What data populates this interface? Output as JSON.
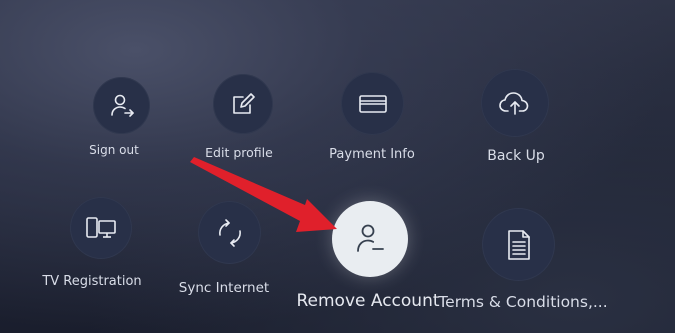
{
  "menu": {
    "items": [
      {
        "label": "Sign out",
        "icon": "sign-out-icon"
      },
      {
        "label": "Edit profile",
        "icon": "edit-profile-icon"
      },
      {
        "label": "Payment Info",
        "icon": "payment-card-icon"
      },
      {
        "label": "Back Up",
        "icon": "cloud-upload-icon"
      },
      {
        "label": "TV Registration",
        "icon": "devices-icon"
      },
      {
        "label": "Sync Internet",
        "icon": "sync-icon"
      },
      {
        "label": "Remove Account",
        "icon": "remove-user-icon"
      },
      {
        "label": "Terms & Conditions,...",
        "icon": "document-icon"
      }
    ],
    "focused_item": "Remove Account"
  },
  "colors": {
    "background": "#222738",
    "circle": "#283048",
    "focused_circle": "#e9edf1",
    "arrow": "#e0202b",
    "label": "#d9dde8"
  }
}
